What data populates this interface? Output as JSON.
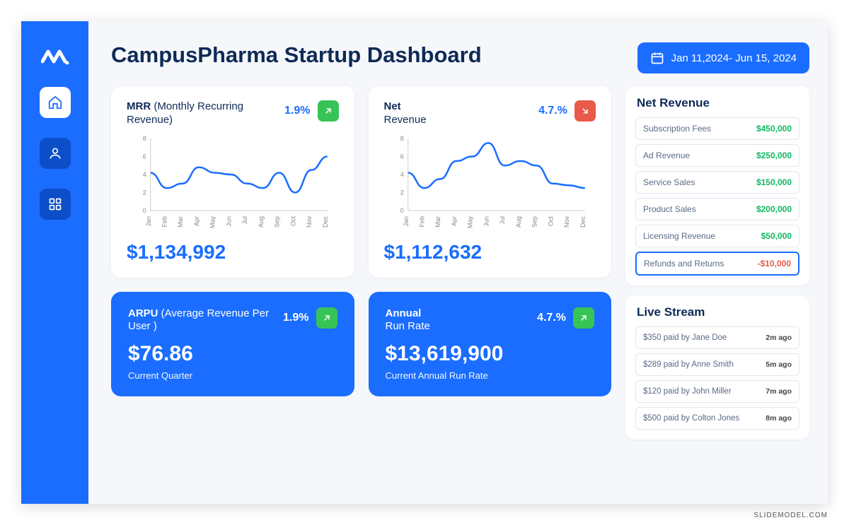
{
  "title": "CampusPharma Startup Dashboard",
  "date_range": "Jan 11,2024- Jun 15, 2024",
  "sidebar": {
    "items": [
      "home",
      "user",
      "apps"
    ],
    "active": 0
  },
  "cards": {
    "mrr": {
      "title_bold": "MRR",
      "title_rest": " (Monthly Recurring Revenue)",
      "pct": "1.9%",
      "direction": "up",
      "value": "$1,134,992"
    },
    "net": {
      "title_bold": "Net",
      "title_rest": "Revenue",
      "pct": "4.7.%",
      "direction": "down",
      "value": "$1,112,632"
    },
    "arpu": {
      "title_bold": "ARPU",
      "title_rest": " (Average Revenue Per User )",
      "pct": "1.9%",
      "direction": "up",
      "value": "$76.86",
      "sub": "Current Quarter"
    },
    "arr": {
      "title_bold": "Annual",
      "title_rest": "Run Rate",
      "pct": "4.7.%",
      "direction": "up",
      "value": "$13,619,900",
      "sub": "Current Annual Run Rate"
    }
  },
  "net_revenue": {
    "title": "Net Revenue",
    "rows": [
      {
        "label": "Subscription Fees",
        "value": "$450,000",
        "pos": true
      },
      {
        "label": "Ad Revenue",
        "value": "$250,000",
        "pos": true
      },
      {
        "label": "Service Sales",
        "value": "$150,000",
        "pos": true
      },
      {
        "label": "Product Sales",
        "value": "$200,000",
        "pos": true
      },
      {
        "label": "Licensing Revenue",
        "value": "$50,000",
        "pos": true
      },
      {
        "label": "Refunds and Returns",
        "value": "-$10,000",
        "pos": false,
        "highlight": true
      }
    ]
  },
  "live_stream": {
    "title": "Live Stream",
    "rows": [
      {
        "text": "$350 paid by Jane Doe",
        "time": "2m ago"
      },
      {
        "text": "$289 paid by Anne Smith",
        "time": "5m ago"
      },
      {
        "text": "$120 paid by John Miller",
        "time": "7m ago"
      },
      {
        "text": "$500 paid by Colton Jones",
        "time": "8m ago"
      }
    ]
  },
  "chart_data": [
    {
      "type": "line",
      "title": "MRR",
      "xlabel": "",
      "ylabel": "",
      "categories": [
        "Jan",
        "Feb",
        "Mar",
        "Apr",
        "May",
        "Jun",
        "Jul",
        "Aug",
        "Sep",
        "Oct",
        "Nov",
        "Dec"
      ],
      "values": [
        4.2,
        2.5,
        3.0,
        4.8,
        4.2,
        4.0,
        3.0,
        2.5,
        4.2,
        2.0,
        4.5,
        6.0
      ],
      "ylim": [
        0,
        8
      ],
      "yticks": [
        0,
        2,
        4,
        6,
        8
      ]
    },
    {
      "type": "line",
      "title": "Net Revenue",
      "xlabel": "",
      "ylabel": "",
      "categories": [
        "Jan",
        "Feb",
        "Mar",
        "Apr",
        "May",
        "Jun",
        "Jul",
        "Aug",
        "Sep",
        "Oct",
        "Nov",
        "Dec"
      ],
      "values": [
        4.2,
        2.5,
        3.5,
        5.5,
        6.0,
        7.5,
        5.0,
        5.5,
        5.0,
        3.0,
        2.8,
        2.5
      ],
      "ylim": [
        0,
        8
      ],
      "yticks": [
        0,
        2,
        4,
        6,
        8
      ]
    }
  ],
  "footer": "SLIDEMODEL.COM"
}
